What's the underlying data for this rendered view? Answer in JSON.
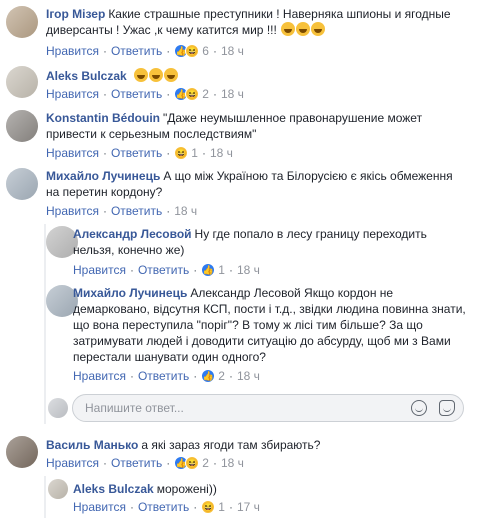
{
  "ui": {
    "like_label": "Нравится",
    "reply_label": "Ответить",
    "reply_placeholder": "Напишите ответ..."
  },
  "comments": [
    {
      "author": "Ігор Мізер",
      "text": "Какие страшные преступники ! Наверняка шпионы и ягодные диверсанты ! Ужас ,к чему катится мир !!!",
      "reactions": "6",
      "time": "18 ч"
    },
    {
      "author": "Aleks Bulczak",
      "text": "",
      "reactions": "2",
      "time": "18 ч"
    },
    {
      "author": "Konstantin Bédouin",
      "text": "\"Даже неумышленное правонарушение может привести к серьезным последствиям\"",
      "reactions": "1",
      "time": "18 ч"
    },
    {
      "author": "Михайло Лучинець",
      "text": "А що між Україною та Білорусією є якісь обмеження на перетин кордону?",
      "time": "18 ч"
    },
    {
      "author": "Александр Лесовой",
      "text": "Ну где попало в лесу границу переходить нельзя, конечно же)",
      "reactions": "1",
      "time": "18 ч"
    },
    {
      "author": "Михайло Лучинець",
      "text": "Александр Лесовой Якщо кордон не демарковано, відсутня КСП, пости і т.д., звідки людина повинна знати, що вона переступила \"поріг\"? В тому ж лісі тим більше? За що затримувати людей і доводити ситуацію до абсурду, щоб ми з Вами перестали шанувати один одного?",
      "reactions": "2",
      "time": "18 ч"
    },
    {
      "author": "Василь Манько",
      "text": "а які зараз ягоди там збирають?",
      "reactions": "2",
      "time": "18 ч"
    },
    {
      "author": "Aleks Bulczak",
      "text": "мороженi))",
      "reactions": "1",
      "time": "17 ч"
    }
  ]
}
